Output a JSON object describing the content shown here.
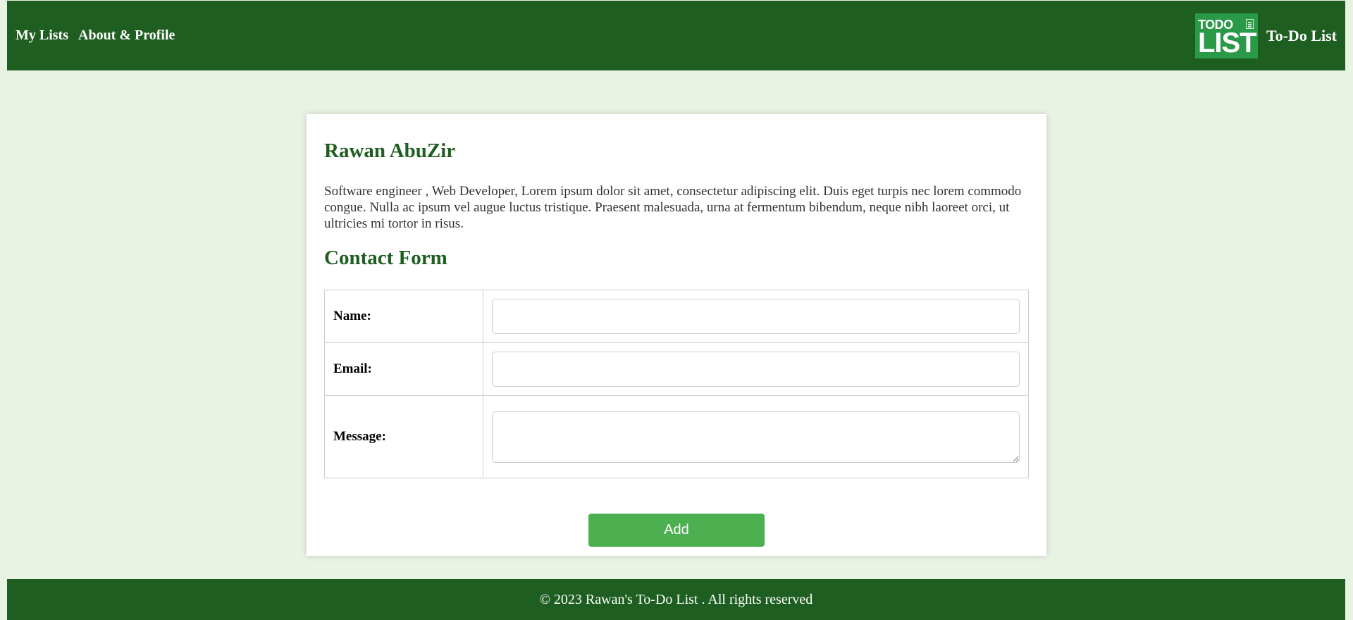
{
  "nav": {
    "items": [
      {
        "label": "My Lists"
      },
      {
        "label": "About & Profile"
      }
    ]
  },
  "brand": {
    "logo_line1": "TODO",
    "logo_line2": "LIST",
    "title": "To-Do List"
  },
  "profile": {
    "name": "Rawan AbuZir",
    "bio": "Software engineer , Web Developer, Lorem ipsum dolor sit amet, consectetur adipiscing elit. Duis eget turpis nec lorem commodo congue. Nulla ac ipsum vel augue luctus tristique. Praesent malesuada, urna at fermentum bibendum, neque nibh laoreet orci, ut ultricies mi tortor in risus."
  },
  "contact": {
    "title": "Contact Form",
    "name_label": "Name:",
    "name_value": "",
    "email_label": "Email:",
    "email_value": "",
    "message_label": "Message:",
    "message_value": "",
    "submit_label": "Add"
  },
  "footer": {
    "text": "© 2023 Rawan's To-Do List . All rights reserved"
  },
  "colors": {
    "header_bg": "#1e5e20",
    "page_bg": "#e9f3e4",
    "accent": "#4caf50",
    "logo_bg": "#2a9a48"
  }
}
